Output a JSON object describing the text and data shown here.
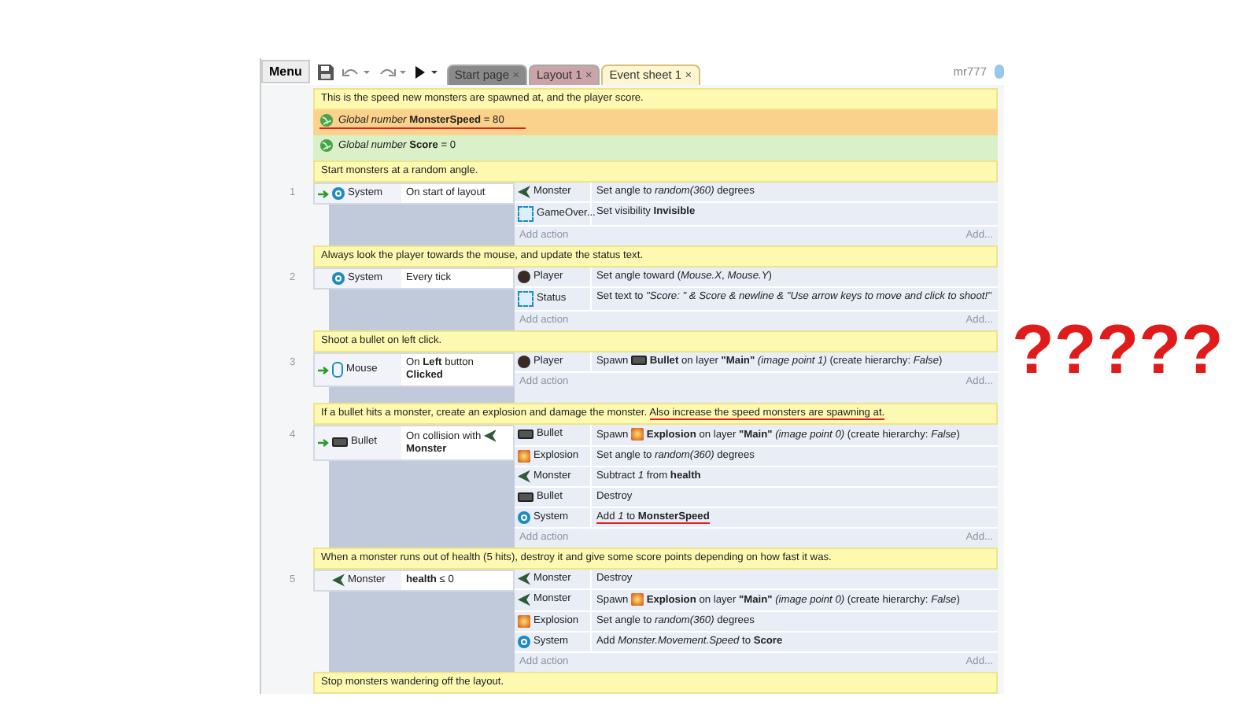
{
  "toolbar": {
    "menu": "Menu",
    "user": "mr777"
  },
  "tabs": [
    {
      "label": "Start page",
      "close": "×",
      "color": "#8a8a8a",
      "selected": false
    },
    {
      "label": "Layout 1",
      "close": "×",
      "color": "#c9a5a8",
      "selected": false
    },
    {
      "label": "Event sheet 1",
      "close": "×",
      "color": "#fdf6d0",
      "selected": true
    }
  ],
  "events": [
    {
      "kind": "comment",
      "parts": [
        {
          "text": "This is the speed new monsters are spawned at, and the player score.",
          "underlined": false
        }
      ]
    },
    {
      "kind": "global",
      "text": "*Global number* **MonsterSpeed** = 80",
      "selected": true,
      "underlined": true
    },
    {
      "kind": "global",
      "text": "*Global number* **Score** = 0",
      "selected": false,
      "underlined": false
    },
    {
      "kind": "comment",
      "parts": [
        {
          "text": "Start monsters at a random angle.",
          "underlined": false
        }
      ]
    },
    {
      "kind": "event",
      "number": "1",
      "trigger": true,
      "conditions": [
        {
          "object": {
            "name": "System",
            "kind": "system"
          },
          "parts": [
            {
              "kind": "text",
              "text": "On start of layout"
            }
          ]
        }
      ],
      "actions": [
        {
          "object": {
            "name": "Monster",
            "kind": "monster"
          },
          "parts": [
            {
              "kind": "text",
              "text": "Set angle to *random(360)* degrees"
            }
          ],
          "underlined": false
        },
        {
          "object": {
            "name": "GameOver...",
            "kind": "text"
          },
          "parts": [
            {
              "kind": "text",
              "text": "Set visibility **Invisible**"
            }
          ],
          "underlined": false
        }
      ],
      "add_action": "Add action",
      "add_more": "Add..."
    },
    {
      "kind": "comment",
      "parts": [
        {
          "text": "Always look the player towards the mouse, and update the status text.",
          "underlined": false
        }
      ]
    },
    {
      "kind": "event",
      "number": "2",
      "trigger": false,
      "conditions": [
        {
          "object": {
            "name": "System",
            "kind": "system"
          },
          "parts": [
            {
              "kind": "text",
              "text": "Every tick"
            }
          ]
        }
      ],
      "actions": [
        {
          "object": {
            "name": "Player",
            "kind": "player"
          },
          "parts": [
            {
              "kind": "text",
              "text": "Set angle toward (*Mouse.X*, *Mouse.Y*)"
            }
          ],
          "underlined": false
        },
        {
          "object": {
            "name": "Status",
            "kind": "text"
          },
          "parts": [
            {
              "kind": "text",
              "text": "Set text to *\"Score: \" & Score & newline & \"Use arrow keys to move and click to shoot!\"*"
            }
          ],
          "underlined": false
        }
      ],
      "add_action": "Add action",
      "add_more": "Add..."
    },
    {
      "kind": "comment",
      "parts": [
        {
          "text": "Shoot a bullet on left click.",
          "underlined": false
        }
      ]
    },
    {
      "kind": "event",
      "number": "3",
      "trigger": true,
      "conditions": [
        {
          "object": {
            "name": "Mouse",
            "kind": "mouse"
          },
          "parts": [
            {
              "kind": "text",
              "text": "On **Left** button **Clicked**"
            }
          ]
        }
      ],
      "actions": [
        {
          "object": {
            "name": "Player",
            "kind": "player"
          },
          "parts": [
            {
              "kind": "text",
              "text": "Spawn "
            },
            {
              "kind": "bullet"
            },
            {
              "kind": "text",
              "text": " **Bullet** on layer **\"Main\"** *(image point 1)* (create hierarchy: *False*)"
            }
          ],
          "underlined": false
        }
      ],
      "add_action": "Add action",
      "add_more": "Add..."
    },
    {
      "kind": "comment",
      "parts": [
        {
          "text": "If a bullet hits a monster, create an explosion and damage the monster. ",
          "underlined": false
        },
        {
          "text": "Also increase the speed monsters are spawning at.",
          "underlined": true
        }
      ]
    },
    {
      "kind": "event",
      "number": "4",
      "trigger": true,
      "conditions": [
        {
          "object": {
            "name": "Bullet",
            "kind": "bullet"
          },
          "parts": [
            {
              "kind": "text",
              "text": "On collision with "
            },
            {
              "kind": "monster"
            },
            {
              "kind": "text",
              "text": " **Monster**"
            }
          ]
        }
      ],
      "actions": [
        {
          "object": {
            "name": "Bullet",
            "kind": "bullet"
          },
          "parts": [
            {
              "kind": "text",
              "text": "Spawn "
            },
            {
              "kind": "explosion"
            },
            {
              "kind": "text",
              "text": " **Explosion** on layer **\"Main\"** *(image point 0)* (create hierarchy: *False*)"
            }
          ],
          "underlined": false
        },
        {
          "object": {
            "name": "Explosion",
            "kind": "explosion"
          },
          "parts": [
            {
              "kind": "text",
              "text": "Set angle to *random(360)* degrees"
            }
          ],
          "underlined": false
        },
        {
          "object": {
            "name": "Monster",
            "kind": "monster"
          },
          "parts": [
            {
              "kind": "text",
              "text": "Subtract *1* from **health**"
            }
          ],
          "underlined": false
        },
        {
          "object": {
            "name": "Bullet",
            "kind": "bullet"
          },
          "parts": [
            {
              "kind": "text",
              "text": "Destroy"
            }
          ],
          "underlined": false
        },
        {
          "object": {
            "name": "System",
            "kind": "system"
          },
          "parts": [
            {
              "kind": "text",
              "text": "Add *1* to **MonsterSpeed**"
            }
          ],
          "underlined": true
        }
      ],
      "add_action": "Add action",
      "add_more": "Add..."
    },
    {
      "kind": "comment",
      "parts": [
        {
          "text": "When a monster runs out of health (5 hits), destroy it and give some score points depending on how fast it was.",
          "underlined": false
        }
      ]
    },
    {
      "kind": "event",
      "number": "5",
      "trigger": false,
      "conditions": [
        {
          "object": {
            "name": "Monster",
            "kind": "monster"
          },
          "parts": [
            {
              "kind": "text",
              "text": "**health** ≤ 0"
            }
          ]
        }
      ],
      "actions": [
        {
          "object": {
            "name": "Monster",
            "kind": "monster"
          },
          "parts": [
            {
              "kind": "text",
              "text": "Destroy"
            }
          ],
          "underlined": false
        },
        {
          "object": {
            "name": "Monster",
            "kind": "monster"
          },
          "parts": [
            {
              "kind": "text",
              "text": "Spawn "
            },
            {
              "kind": "explosion"
            },
            {
              "kind": "text",
              "text": " **Explosion** on layer **\"Main\"** *(image point 0)* (create hierarchy: *False*)"
            }
          ],
          "underlined": false
        },
        {
          "object": {
            "name": "Explosion",
            "kind": "explosion"
          },
          "parts": [
            {
              "kind": "text",
              "text": "Set angle to *random(360)* degrees"
            }
          ],
          "underlined": false
        },
        {
          "object": {
            "name": "System",
            "kind": "system"
          },
          "parts": [
            {
              "kind": "text",
              "text": "Add *Monster.Movement.Speed* to **Score**"
            }
          ],
          "underlined": false
        }
      ],
      "add_action": "Add action",
      "add_more": "Add..."
    },
    {
      "kind": "comment",
      "parts": [
        {
          "text": "Stop monsters wandering off the layout.",
          "underlined": false
        }
      ]
    }
  ],
  "annotation": "?????"
}
